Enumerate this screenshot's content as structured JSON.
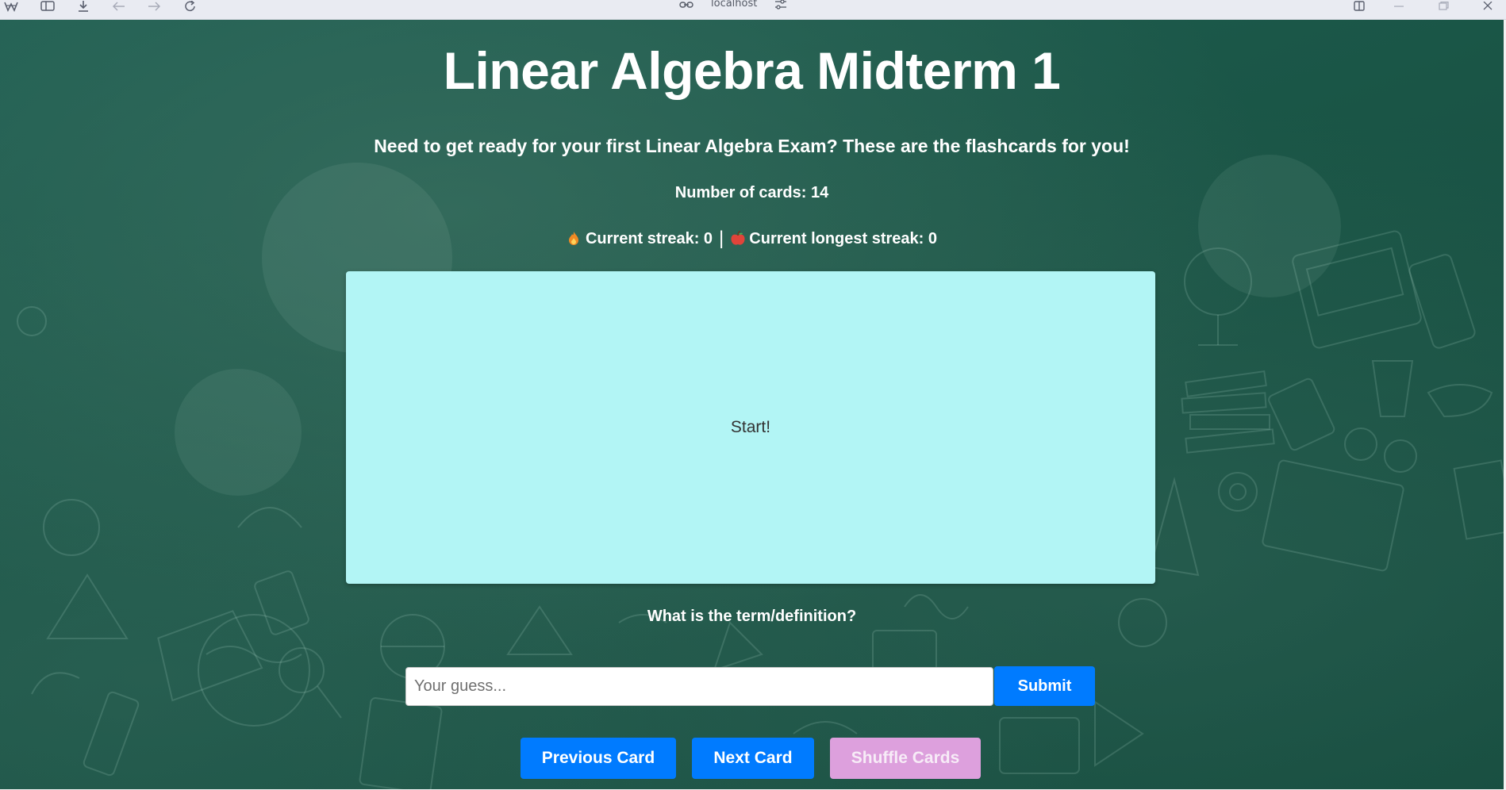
{
  "browser": {
    "address": "localhost",
    "icons": [
      "app-logo-icon",
      "sidebar-icon",
      "download-icon",
      "back-icon",
      "forward-icon",
      "reload-icon",
      "site-info-icon",
      "site-settings-icon",
      "split-view-icon",
      "minimize-icon",
      "maximize-icon",
      "close-icon"
    ]
  },
  "page": {
    "title": "Linear Algebra Midterm 1",
    "subtitle": "Need to get ready for your first Linear Algebra Exam? These are the flashcards for you!",
    "card_count": "Number of cards: 14",
    "streak": {
      "current": "Current streak: 0",
      "separator": "|",
      "longest": "Current longest streak: 0"
    },
    "card": {
      "text": "Start!"
    },
    "prompt": "What is the term/definition?",
    "guess": {
      "placeholder": "Your guess...",
      "value": ""
    },
    "submit_label": "Submit",
    "buttons": {
      "previous": "Previous Card",
      "next": "Next Card",
      "shuffle": "Shuffle Cards"
    }
  },
  "colors": {
    "background": "#1a5546",
    "card": "#b2f5f5",
    "primary_button": "#007bff",
    "shuffle_button": "#dda0dd"
  }
}
